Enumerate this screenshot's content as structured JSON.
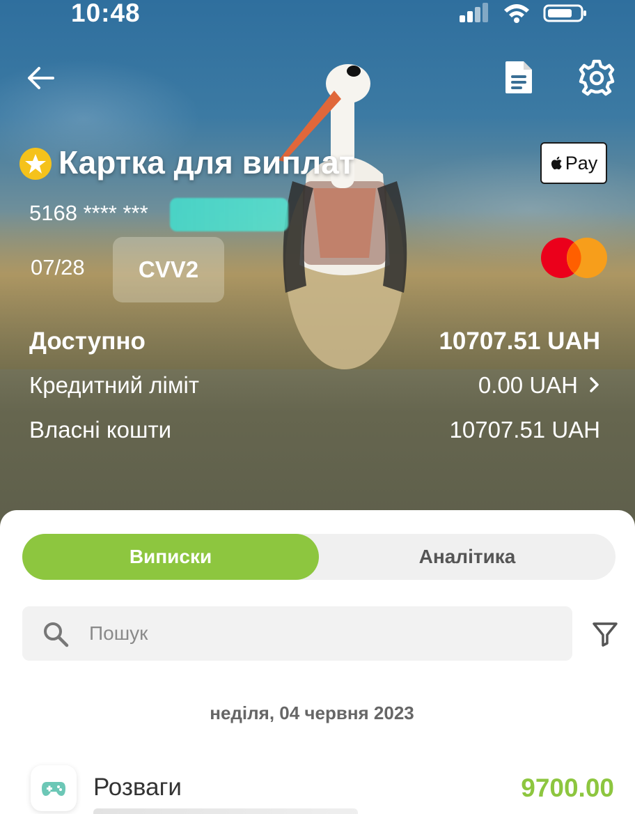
{
  "status_bar": {
    "time": "10:48"
  },
  "card": {
    "title": "Картка для виплат",
    "number_visible": "5168 **** ***",
    "expiry": "07/28",
    "cvv_label": "CVV2",
    "apple_pay_label": "Pay"
  },
  "balances": {
    "available_label": "Доступно",
    "available_value": "10707.51 UAH",
    "credit_label": "Кредитний ліміт",
    "credit_value": "0.00 UAH",
    "own_label": "Власні кошти",
    "own_value": "10707.51 UAH"
  },
  "tabs": [
    {
      "label": "Виписки",
      "active": true
    },
    {
      "label": "Аналітика",
      "active": false
    }
  ],
  "search": {
    "placeholder": "Пошук"
  },
  "date_header": "неділя, 04 червня 2023",
  "transactions": [
    {
      "name": "Розваги",
      "amount": "9700.00",
      "icon": "gamepad-icon"
    }
  ],
  "colors": {
    "accent": "#8dc63f",
    "star": "#f5c21b",
    "mastercard_red": "#eb001b",
    "mastercard_orange": "#f79e1b",
    "redaction": "#48d6c8"
  },
  "icons": [
    "back-arrow-icon",
    "document-icon",
    "gear-icon",
    "star-icon",
    "apple-icon",
    "mastercard-icon",
    "search-icon",
    "filter-icon",
    "gamepad-icon"
  ]
}
